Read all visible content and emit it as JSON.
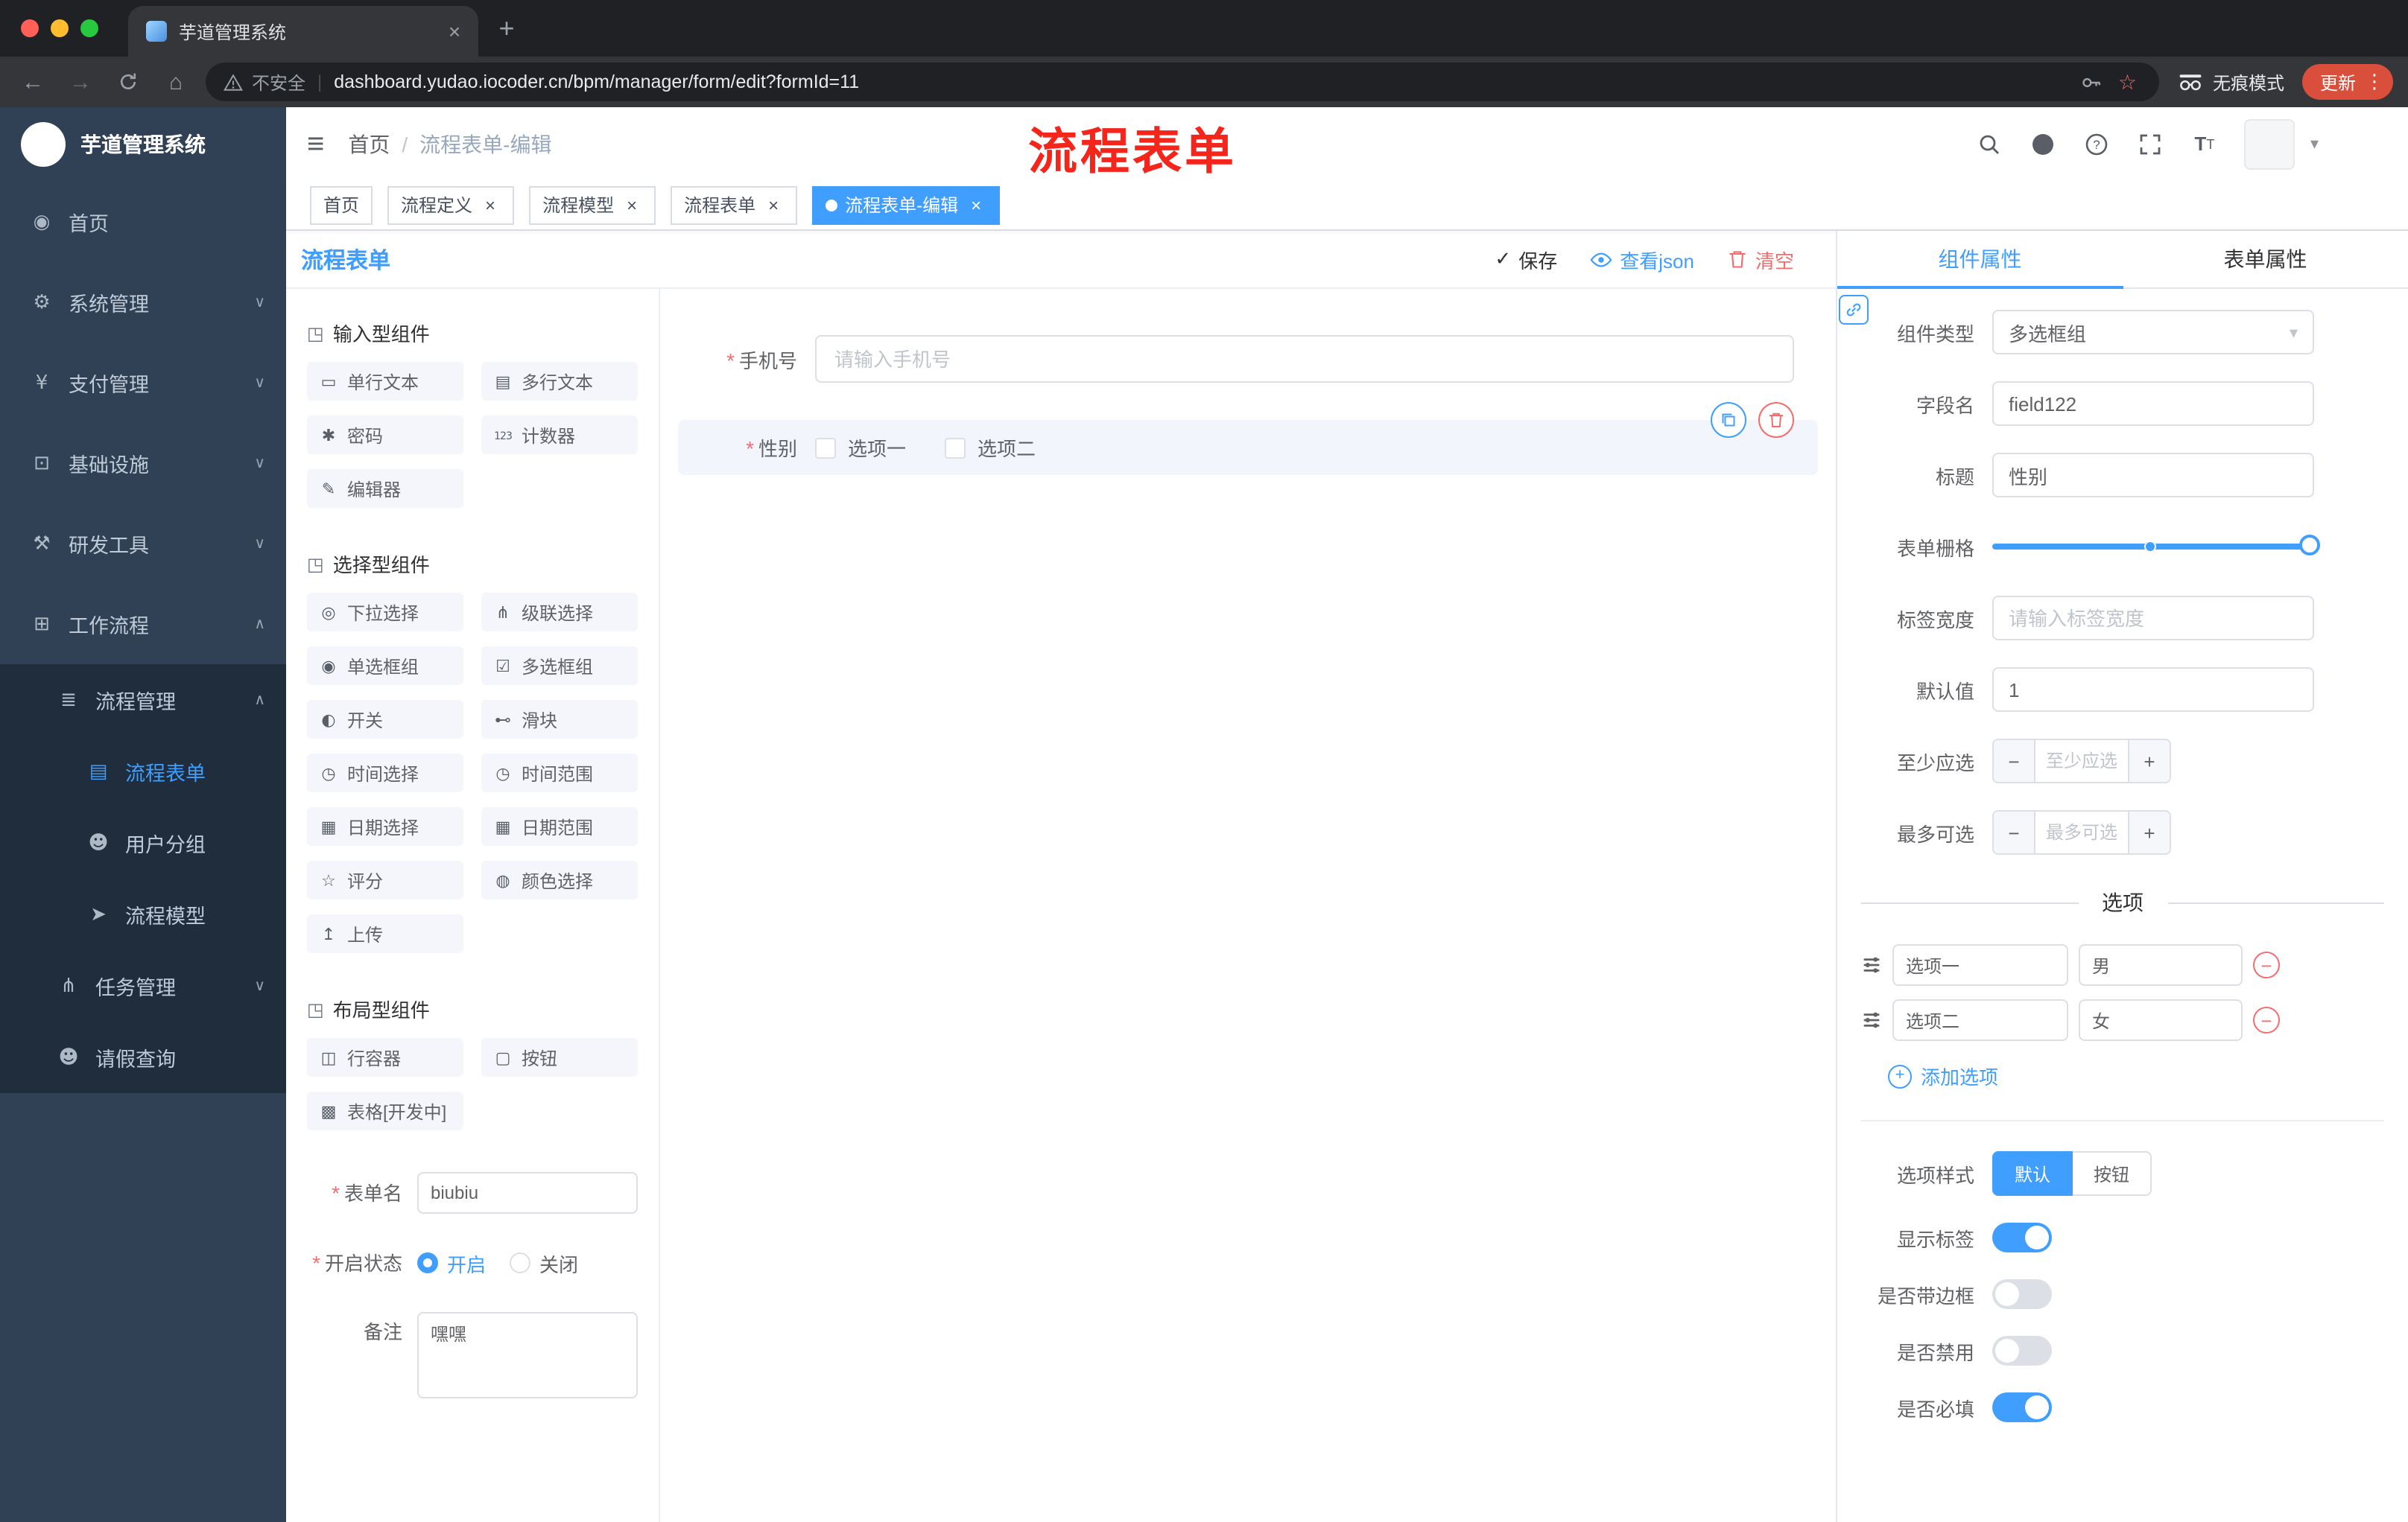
{
  "browser": {
    "tab_title": "芋道管理系统",
    "security_label": "不安全",
    "url": "dashboard.yudao.iocoder.cn/bpm/manager/form/edit?formId=11",
    "incognito_label": "无痕模式",
    "update_button": "更新"
  },
  "annotation": {
    "text": "流程表单",
    "color": "#f4261c"
  },
  "sidebar": {
    "title": "芋道管理系统",
    "items": [
      {
        "label": "首页",
        "icon": "home",
        "depth": 0
      },
      {
        "label": "系统管理",
        "icon": "gear",
        "depth": 0,
        "chevron": "down"
      },
      {
        "label": "支付管理",
        "icon": "yen",
        "depth": 0,
        "chevron": "down"
      },
      {
        "label": "基础设施",
        "icon": "monitor",
        "depth": 0,
        "chevron": "down"
      },
      {
        "label": "研发工具",
        "icon": "tools",
        "depth": 0,
        "chevron": "down"
      },
      {
        "label": "工作流程",
        "icon": "workflow",
        "depth": 0,
        "chevron": "up"
      },
      {
        "label": "流程管理",
        "icon": "process-list",
        "depth": 1,
        "chevron": "up"
      },
      {
        "label": "流程表单",
        "icon": "form-doc",
        "depth": 2,
        "active": true
      },
      {
        "label": "用户分组",
        "icon": "user-group",
        "depth": 2
      },
      {
        "label": "流程模型",
        "icon": "paper-plane",
        "depth": 2
      },
      {
        "label": "任务管理",
        "icon": "task-tree",
        "depth": 1,
        "chevron": "down"
      },
      {
        "label": "请假查询",
        "icon": "person",
        "depth": 1
      }
    ]
  },
  "header": {
    "breadcrumb": [
      "首页",
      "流程表单-编辑"
    ],
    "breadcrumb_separator": "/"
  },
  "tags": [
    {
      "label": "首页"
    },
    {
      "label": "流程定义",
      "closable": true
    },
    {
      "label": "流程模型",
      "closable": true
    },
    {
      "label": "流程表单",
      "closable": true
    },
    {
      "label": "流程表单-编辑",
      "closable": true,
      "active": true
    }
  ],
  "designer": {
    "panel_title": "流程表单",
    "actions": {
      "save": "保存",
      "view_json": "查看json",
      "clear": "清空"
    },
    "groups": [
      {
        "title": "输入型组件",
        "items": [
          {
            "label": "单行文本",
            "icon": "single-line-input"
          },
          {
            "label": "多行文本",
            "icon": "multi-line-input"
          },
          {
            "label": "密码",
            "icon": "password"
          },
          {
            "label": "计数器",
            "icon": "counter"
          },
          {
            "label": "编辑器",
            "icon": "editor"
          }
        ]
      },
      {
        "title": "选择型组件",
        "items": [
          {
            "label": "下拉选择",
            "icon": "select"
          },
          {
            "label": "级联选择",
            "icon": "cascader"
          },
          {
            "label": "单选框组",
            "icon": "radio-group"
          },
          {
            "label": "多选框组",
            "icon": "checkbox-group"
          },
          {
            "label": "开关",
            "icon": "switch"
          },
          {
            "label": "滑块",
            "icon": "slider"
          },
          {
            "label": "时间选择",
            "icon": "time-picker"
          },
          {
            "label": "时间范围",
            "icon": "time-range"
          },
          {
            "label": "日期选择",
            "icon": "date-picker"
          },
          {
            "label": "日期范围",
            "icon": "date-range"
          },
          {
            "label": "评分",
            "icon": "rate"
          },
          {
            "label": "颜色选择",
            "icon": "color-picker"
          },
          {
            "label": "上传",
            "icon": "upload"
          }
        ]
      },
      {
        "title": "布局型组件",
        "items": [
          {
            "label": "行容器",
            "icon": "row-container"
          },
          {
            "label": "按钮",
            "icon": "button"
          },
          {
            "label": "表格[开发中]",
            "icon": "table"
          }
        ]
      }
    ],
    "meta_form": {
      "form_name_label": "表单名",
      "form_name_value": "biubiu",
      "status_label": "开启状态",
      "status_options": [
        {
          "label": "开启",
          "checked": true
        },
        {
          "label": "关闭",
          "checked": false
        }
      ],
      "remark_label": "备注",
      "remark_value": "嘿嘿"
    }
  },
  "canvas": {
    "phone_field": {
      "label": "手机号",
      "required": true,
      "placeholder": "请输入手机号"
    },
    "gender_field": {
      "label": "性别",
      "required": true,
      "selected": true,
      "options": [
        "选项一",
        "选项二"
      ]
    }
  },
  "props_panel": {
    "tabs": [
      {
        "label": "组件属性",
        "active": true
      },
      {
        "label": "表单属性",
        "active": false
      }
    ],
    "fields": {
      "component_type": {
        "label": "组件类型",
        "value": "多选框组"
      },
      "field_name": {
        "label": "字段名",
        "value": "field122"
      },
      "title": {
        "label": "标题",
        "value": "性别"
      },
      "grid": {
        "label": "表单栅格"
      },
      "label_width": {
        "label": "标签宽度",
        "placeholder": "请输入标签宽度"
      },
      "default_value": {
        "label": "默认值",
        "value": "1"
      },
      "min_select": {
        "label": "至少应选",
        "placeholder": "至少应选"
      },
      "max_select": {
        "label": "最多可选",
        "placeholder": "最多可选"
      }
    },
    "options_section": {
      "title": "选项",
      "rows": [
        {
          "label": "选项一",
          "value": "男"
        },
        {
          "label": "选项二",
          "value": "女"
        }
      ],
      "add_label": "添加选项"
    },
    "style_section": {
      "option_style_label": "选项样式",
      "option_style_choices": [
        {
          "label": "默认",
          "active": true
        },
        {
          "label": "按钮",
          "active": false
        }
      ],
      "switches": [
        {
          "label": "显示标签",
          "on": true
        },
        {
          "label": "是否带边框",
          "on": false
        },
        {
          "label": "是否禁用",
          "on": false
        },
        {
          "label": "是否必填",
          "on": true
        }
      ]
    },
    "colors": {
      "primary": "#409EFF",
      "danger": "#F56C6C"
    }
  }
}
